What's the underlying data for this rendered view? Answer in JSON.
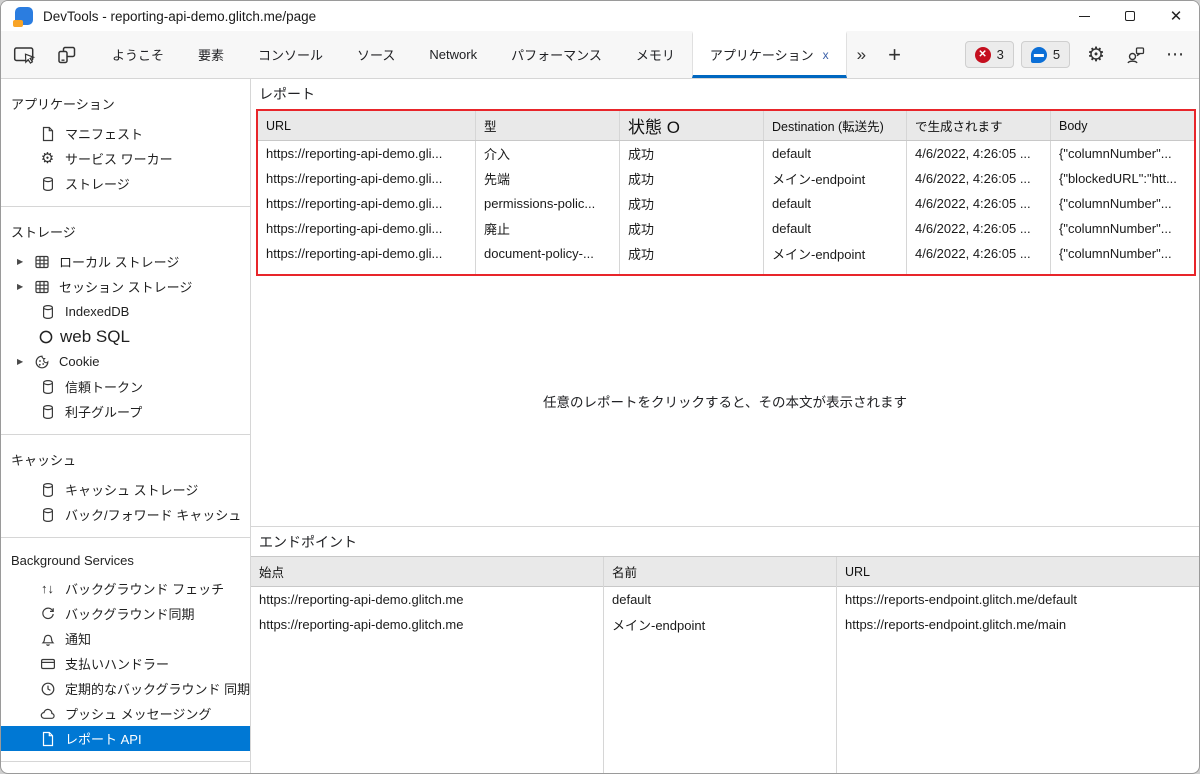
{
  "window": {
    "title": "DevTools - reporting-api-demo.glitch.me/page"
  },
  "toolbar": {
    "tabs": [
      "ようこそ",
      "要素",
      "コンソール",
      "ソース",
      "Network",
      "パフォーマンス",
      "メモリ",
      "アプリケーション"
    ],
    "active_tab": "アプリケーション",
    "more_tabs_glyph": "»",
    "new_tab_glyph": "+",
    "error_count": "3",
    "issue_count": "5"
  },
  "sidebar": {
    "sections": [
      {
        "title": "アプリケーション",
        "items": [
          {
            "label": "マニフェスト"
          },
          {
            "label": "サービス ワーカー"
          },
          {
            "label": "ストレージ"
          }
        ]
      },
      {
        "title": "ストレージ",
        "items": [
          {
            "label": "ローカル ストレージ"
          },
          {
            "label": "セッション ストレージ"
          },
          {
            "label": "IndexedDB"
          },
          {
            "label": "web SQL"
          },
          {
            "label": "Cookie"
          },
          {
            "label": "信頼トークン"
          },
          {
            "label": "利子グループ"
          }
        ]
      },
      {
        "title": "キャッシュ",
        "items": [
          {
            "label": "キャッシュ ストレージ"
          },
          {
            "label": "バック/フォワード キャッシュ"
          }
        ]
      },
      {
        "title": "Background Services",
        "items": [
          {
            "label": "バックグラウンド フェッチ"
          },
          {
            "label": "バックグラウンド同期"
          },
          {
            "label": "通知"
          },
          {
            "label": "支払いハンドラー"
          },
          {
            "label": "定期的なバックグラウンド 同期"
          },
          {
            "label": "プッシュ メッセージング"
          },
          {
            "label": "レポート API"
          }
        ]
      }
    ],
    "selected_item": "レポート API"
  },
  "reports": {
    "title": "レポート",
    "columns": [
      "URL",
      "型",
      "状態 O",
      "Destination (転送先)",
      "で生成されます",
      "Body"
    ],
    "rows": [
      [
        "https://reporting-api-demo.gli...",
        "介入",
        "成功",
        "default",
        "4/6/2022, 4:26:05 ...",
        "{\"columnNumber\"..."
      ],
      [
        "https://reporting-api-demo.gli...",
        "先端",
        "成功",
        "メイン-endpoint",
        "4/6/2022, 4:26:05 ...",
        "{\"blockedURL\":\"htt..."
      ],
      [
        "https://reporting-api-demo.gli...",
        "permissions-polic...",
        "成功",
        "default",
        "4/6/2022, 4:26:05 ...",
        "{\"columnNumber\"..."
      ],
      [
        "https://reporting-api-demo.gli...",
        "廃止",
        "成功",
        "default",
        "4/6/2022, 4:26:05 ...",
        "{\"columnNumber\"..."
      ],
      [
        "https://reporting-api-demo.gli...",
        "document-policy-...",
        "成功",
        "メイン-endpoint",
        "4/6/2022, 4:26:05 ...",
        "{\"columnNumber\"..."
      ]
    ],
    "empty_message": "任意のレポートをクリックすると、その本文が表示されます"
  },
  "endpoints": {
    "title": "エンドポイント",
    "columns": [
      "始点",
      "名前",
      "URL"
    ],
    "rows": [
      [
        "https://reporting-api-demo.glitch.me",
        "default",
        "https://reports-endpoint.glitch.me/default"
      ],
      [
        "https://reporting-api-demo.glitch.me",
        "メイン-endpoint",
        "https://reports-endpoint.glitch.me/main"
      ]
    ]
  },
  "colors": {
    "tab_accent": "#0067c0",
    "selected_item_bg": "#0078d4",
    "annotation_border": "#e8252a",
    "error_badge": "#c50f1f",
    "issues_badge": "#0b6fd7"
  }
}
